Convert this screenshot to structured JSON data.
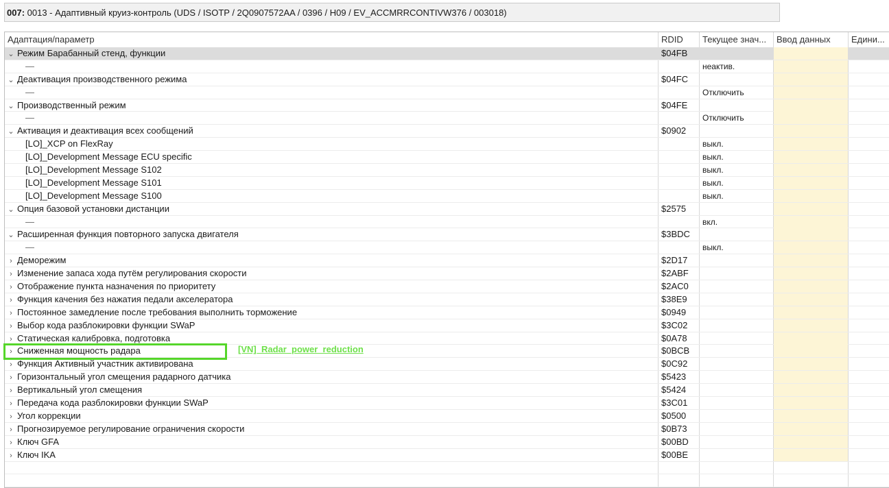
{
  "title": {
    "id": "007:",
    "text": " 0013 - Адаптивный круиз-контроль  (UDS / ISOTP / 2Q0907572AA / 0396 / H09 / EV_ACCMRRCONTIVW376 / 003018)"
  },
  "columns": {
    "name": "Адаптация/параметр",
    "rdid": "RDID",
    "current": "Текущее знач...",
    "input": "Ввод данных",
    "unit": "Едини..."
  },
  "icons": {
    "expanded": "chevron-down-icon",
    "collapsed": "chevron-right-icon"
  },
  "colors": {
    "input_bg": "#fdf5d6",
    "selected_bg": "#dcdcdc",
    "highlight": "#55d62a",
    "annotation": "#6ee04a"
  },
  "rows": [
    {
      "type": "group",
      "expanded": true,
      "selected": true,
      "name": "Режим Барабанный стенд, функции",
      "rdid": "$04FB"
    },
    {
      "type": "sub",
      "name": "—",
      "value": "неактив."
    },
    {
      "type": "group",
      "expanded": true,
      "name": "Деактивация производственного режима",
      "rdid": "$04FC"
    },
    {
      "type": "sub",
      "name": "—",
      "value": "Отключить"
    },
    {
      "type": "group",
      "expanded": true,
      "name": "Производственный режим",
      "rdid": "$04FE"
    },
    {
      "type": "sub",
      "name": "—",
      "value": "Отключить"
    },
    {
      "type": "group",
      "expanded": true,
      "name": "Активация и деактивация всех сообщений",
      "rdid": "$0902"
    },
    {
      "type": "sub",
      "name": "[LO]_XCP on FlexRay",
      "value": "выкл."
    },
    {
      "type": "sub",
      "name": "[LO]_Development Message ECU specific",
      "value": "выкл."
    },
    {
      "type": "sub",
      "name": "[LO]_Development Message S102",
      "value": "выкл."
    },
    {
      "type": "sub",
      "name": "[LO]_Development Message S101",
      "value": "выкл."
    },
    {
      "type": "sub",
      "name": "[LO]_Development Message S100",
      "value": "выкл."
    },
    {
      "type": "group",
      "expanded": true,
      "name": "Опция базовой установки дистанции",
      "rdid": "$2575"
    },
    {
      "type": "sub",
      "name": "—",
      "value": "вкл."
    },
    {
      "type": "group",
      "expanded": true,
      "name": "Расширенная функция повторного запуска двигателя",
      "rdid": "$3BDC"
    },
    {
      "type": "sub",
      "name": "—",
      "value": "выкл."
    },
    {
      "type": "group",
      "expanded": false,
      "name": "Деморежим",
      "rdid": "$2D17"
    },
    {
      "type": "group",
      "expanded": false,
      "name": "Изменение запаса хода путём регулирования скорости",
      "rdid": "$2ABF"
    },
    {
      "type": "group",
      "expanded": false,
      "name": "Отображение пункта назначения по приоритету",
      "rdid": "$2AC0"
    },
    {
      "type": "group",
      "expanded": false,
      "name": "Функция качения без нажатия педали акселератора",
      "rdid": "$38E9"
    },
    {
      "type": "group",
      "expanded": false,
      "name": "Постоянное замедление после требования выполнить торможение",
      "rdid": "$0949"
    },
    {
      "type": "group",
      "expanded": false,
      "name": "Выбор кода разблокировки функции SWaP",
      "rdid": "$3C02"
    },
    {
      "type": "group",
      "expanded": false,
      "name": "Статическая калибровка, подготовка",
      "rdid": "$0A78"
    },
    {
      "type": "group",
      "expanded": false,
      "name": "Сниженная мощность радара",
      "rdid": "$0BCB"
    },
    {
      "type": "group",
      "expanded": false,
      "name": "Функция Активный участник активирована",
      "rdid": "$0C92"
    },
    {
      "type": "group",
      "expanded": false,
      "name": "Горизонтальный угол смещения радарного датчика",
      "rdid": "$5423"
    },
    {
      "type": "group",
      "expanded": false,
      "name": "Вертикальный угол смещения",
      "rdid": "$5424"
    },
    {
      "type": "group",
      "expanded": false,
      "name": "Передача кода разблокировки функции SWaP",
      "rdid": "$3C01"
    },
    {
      "type": "group",
      "expanded": false,
      "name": "Угол коррекции",
      "rdid": "$0500"
    },
    {
      "type": "group",
      "expanded": false,
      "name": "Прогнозируемое регулирование ограничения скорости",
      "rdid": "$0B73"
    },
    {
      "type": "group",
      "expanded": false,
      "name": "Ключ GFA",
      "rdid": "$00BD"
    },
    {
      "type": "group",
      "expanded": false,
      "name": "Ключ IKA",
      "rdid": "$00BE"
    },
    {
      "type": "empty"
    },
    {
      "type": "empty"
    }
  ],
  "annotation": {
    "text": "[VN]_Radar_power_reduction"
  }
}
